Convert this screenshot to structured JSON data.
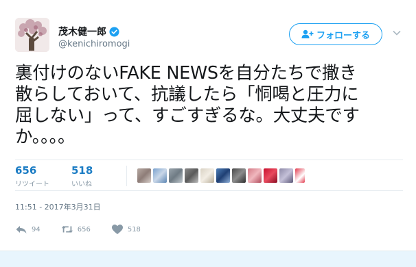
{
  "author": {
    "name": "茂木健一郎",
    "handle": "@kenichiromogi"
  },
  "follow_button": {
    "label": "フォローする"
  },
  "tweet": {
    "lines": [
      "裏付けのないFAKE NEWSを自分たちで撒き",
      "散らしておいて、抗議したら「恫喝と圧力に",
      "屈しない」って、すごすぎるな。大丈夫です",
      "か。。。。"
    ]
  },
  "stats": {
    "retweets": {
      "count": "656",
      "label": "リツイート"
    },
    "likes": {
      "count": "518",
      "label": "いいね"
    }
  },
  "timestamp": "11:51 - 2017年3月31日",
  "actions": {
    "reply_count": "94",
    "retweet_count": "656",
    "like_count": "518"
  },
  "colors": {
    "accent": "#1da1f2",
    "stat_count": "#1b7cc4",
    "muted": "#8899a6"
  },
  "icons": [
    "verified-icon",
    "follow-icon",
    "caret-down-icon",
    "reply-icon",
    "retweet-icon",
    "heart-icon"
  ]
}
